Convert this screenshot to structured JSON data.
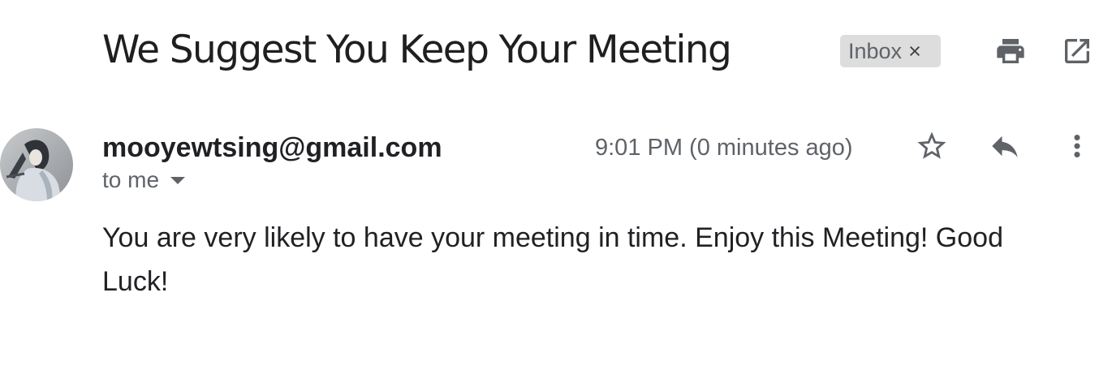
{
  "email": {
    "subject": "We Suggest You Keep Your Meeting",
    "label": "Inbox",
    "label_remove_glyph": "×",
    "sender": "mooyewtsing@gmail.com",
    "recipient": "to me",
    "time": "9:01 PM (0 minutes ago)",
    "body": "You are very likely to have your meeting in time. Enjoy this Meeting! Good Luck!"
  },
  "icons": {
    "print": "print-icon",
    "open_new_window": "open-in-new-window-icon",
    "star": "star-outline-icon",
    "reply": "reply-icon",
    "more": "more-vertical-icon",
    "avatar": "sender-avatar"
  },
  "colors": {
    "text_primary": "#202124",
    "text_secondary": "#5f6368",
    "chip_background": "#dddddd"
  }
}
